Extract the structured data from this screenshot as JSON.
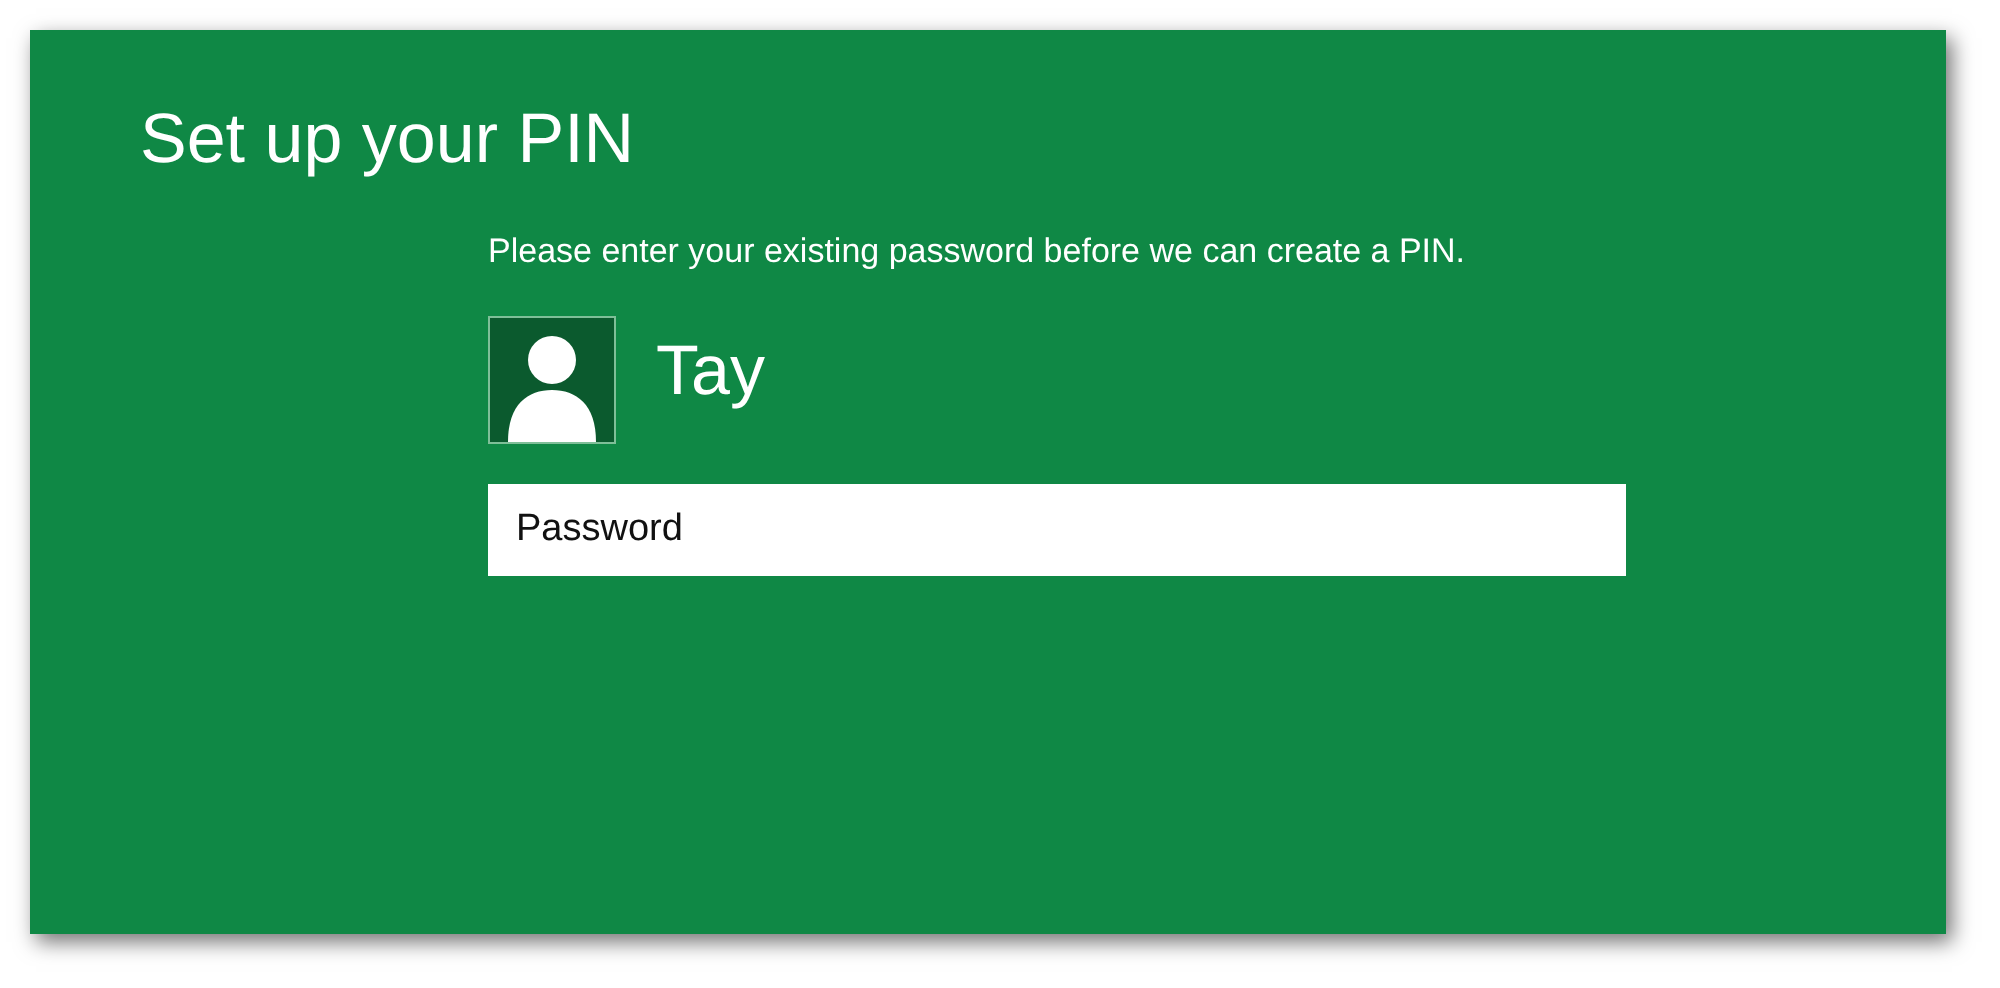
{
  "title": "Set up your PIN",
  "message": "Please enter your existing password before we can create a PIN.",
  "user": {
    "name": "Tay"
  },
  "password_field": {
    "placeholder": "Password"
  }
}
